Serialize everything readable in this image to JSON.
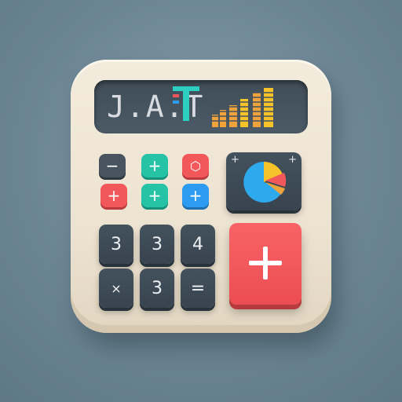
{
  "app_icon": {
    "name": "Calculator"
  },
  "display": {
    "text": "J.A.T"
  },
  "top_keys": [
    {
      "symbol": "−",
      "color": "#47545f"
    },
    {
      "symbol": "+",
      "color": "#27c3a6"
    },
    {
      "symbol": "⬡",
      "color": "#f2585a"
    },
    {
      "symbol": "+",
      "color": "#f2585a"
    },
    {
      "symbol": "+",
      "color": "#27c3a6"
    },
    {
      "symbol": "+",
      "color": "#2d9cf0"
    }
  ],
  "number_keys": [
    {
      "label": "3"
    },
    {
      "label": "3"
    },
    {
      "label": "4"
    },
    {
      "label": "×"
    },
    {
      "label": "3"
    },
    {
      "label": "="
    }
  ],
  "big_key": {
    "label": "+"
  },
  "pie_panel": {
    "corner_left": "+",
    "corner_right": "+"
  },
  "colors": {
    "body": "#efe6d5",
    "screen": "#44525e",
    "accent_red": "#f2585a",
    "accent_teal": "#27c3a6",
    "accent_blue": "#2d9cf0",
    "accent_yellow": "#f6c42a",
    "accent_orange": "#f0a33a"
  }
}
